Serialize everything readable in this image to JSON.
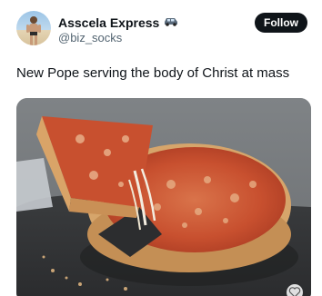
{
  "author": {
    "display_name": "Asscela Express",
    "handle": "@biz_socks",
    "name_badge_icon": "car-emoji-icon",
    "avatar_icon": "profile-avatar"
  },
  "actions": {
    "follow_label": "Follow"
  },
  "tweet": {
    "text": "New Pope serving the body of Christ at mass"
  },
  "media": {
    "image_subject": "deep-dish pizza with slice being lifted",
    "corner_icon": "heart-icon"
  },
  "colors": {
    "text_primary": "#0f1419",
    "text_secondary": "#536471",
    "follow_bg": "#0f1419",
    "follow_text": "#ffffff"
  }
}
